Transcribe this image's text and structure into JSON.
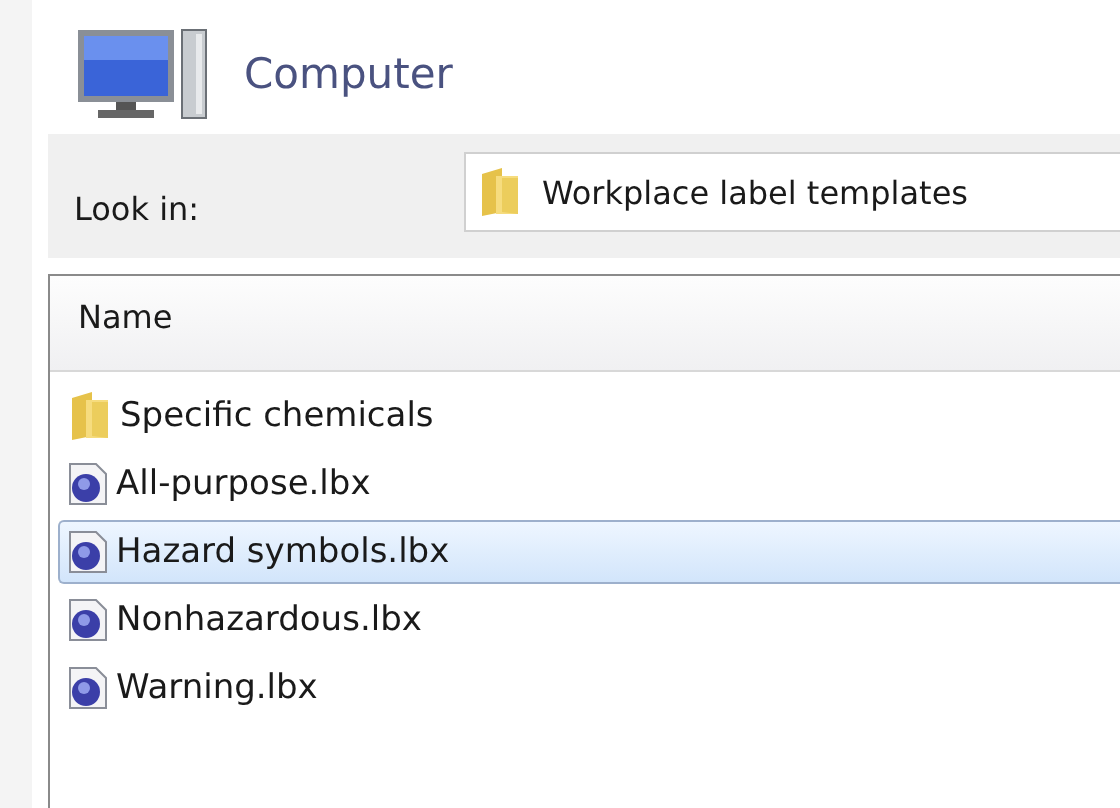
{
  "location": {
    "title": "Computer"
  },
  "look_in": {
    "label": "Look in:",
    "value": "Workplace label templates"
  },
  "file_list": {
    "columns": [
      "Name"
    ],
    "rows": [
      {
        "kind": "folder",
        "name": "Specific chemicals",
        "selected": false
      },
      {
        "kind": "file",
        "name": "All-purpose.lbx",
        "selected": false
      },
      {
        "kind": "file",
        "name": "Hazard symbols.lbx",
        "selected": true
      },
      {
        "kind": "file",
        "name": "Nonhazardous.lbx",
        "selected": false
      },
      {
        "kind": "file",
        "name": "Warning.lbx",
        "selected": false
      }
    ]
  }
}
